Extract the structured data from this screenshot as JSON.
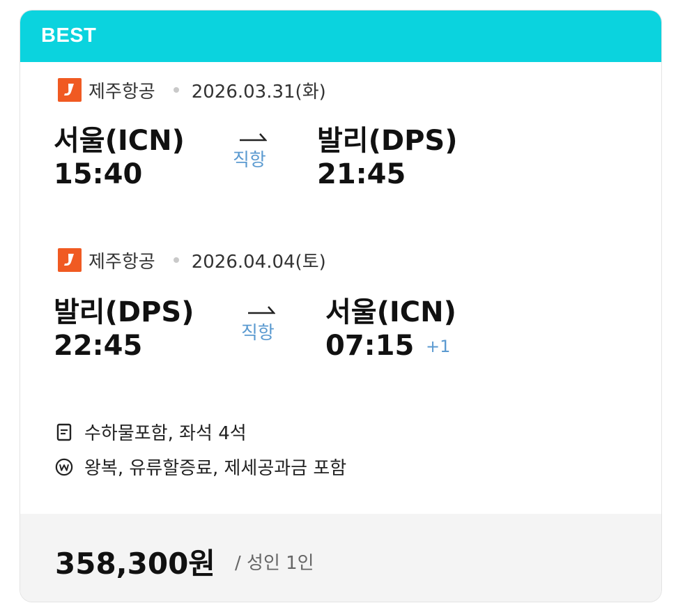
{
  "badge": "BEST",
  "legs": [
    {
      "airline": "제주항공",
      "date": "2026.03.31(화)",
      "from_city": "서울(ICN)",
      "to_city": "발리(DPS)",
      "depart_time": "15:40",
      "arrive_time": "21:45",
      "stop_type": "직항",
      "day_offset": ""
    },
    {
      "airline": "제주항공",
      "date": "2026.04.04(토)",
      "from_city": "발리(DPS)",
      "to_city": "서울(ICN)",
      "depart_time": "22:45",
      "arrive_time": "07:15",
      "stop_type": "직항",
      "day_offset": "+1"
    }
  ],
  "info": {
    "baggage": "수하물포함, 좌석 4석",
    "fare_note": "왕복, 유류할증료, 제세공과금 포함"
  },
  "price": {
    "amount": "358,300원",
    "per": "/ 성인 1인"
  },
  "colors": {
    "badge_bg": "#0bd3de",
    "airline_logo": "#f05a22",
    "accent_blue": "#5b9ad0",
    "footer_bg": "#f4f4f4"
  }
}
